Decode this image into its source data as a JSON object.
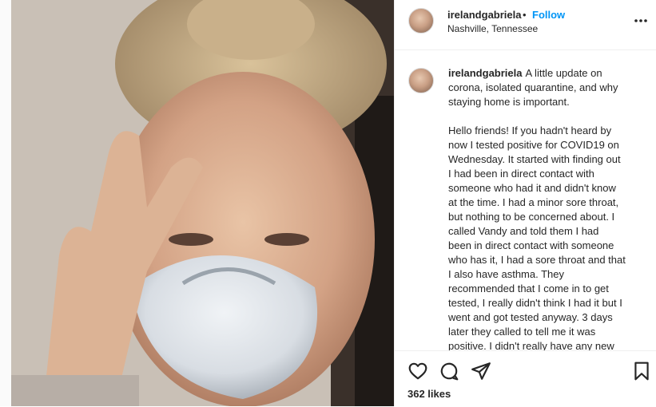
{
  "post": {
    "username": "irelandgabriela",
    "separator": "•",
    "follow_label": "Follow",
    "location": "Nashville, Tennessee",
    "caption_lines": [
      "A little update on",
      "corona, isolated quarantine, and why",
      "staying home is important.",
      "",
      "Hello friends! If you hadn't heard by",
      "now I tested positive for COVID19 on",
      "Wednesday. It started with finding out",
      "I had been in direct contact with",
      "someone who had it and didn't know",
      "at the time. I had a minor sore throat,",
      "but nothing to be concerned about. I",
      "called Vandy and told them I had",
      "been in direct contact with someone",
      "who has it, I had a sore throat and that",
      "I also have asthma. They",
      "recommended that I come in to get",
      "tested, I really didn't think I had it but I",
      "went and got tested anyway. 3 days",
      "later they called to tell me it was",
      "positive. I didn't really have any new"
    ],
    "likes_label": "362 likes"
  },
  "icons": {
    "more": "more-options-icon",
    "like": "heart-icon",
    "comment": "comment-icon",
    "share": "paper-plane-icon",
    "save": "bookmark-icon"
  },
  "colors": {
    "follow": "#0095f6",
    "text": "#262626",
    "divider": "#efefef"
  }
}
